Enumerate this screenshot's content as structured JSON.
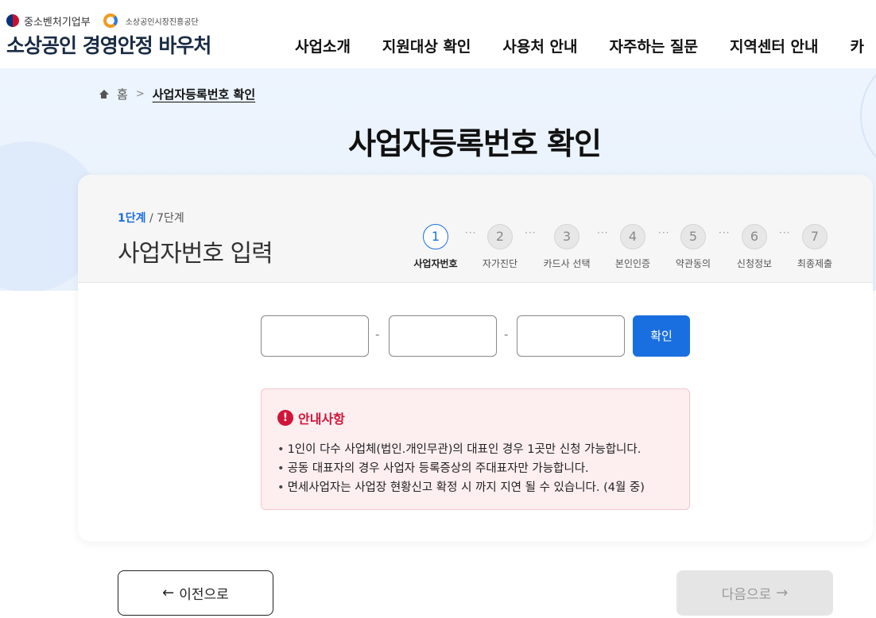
{
  "header": {
    "ministry": "중소벤처기업부",
    "agency": "소상공인시장진흥공단",
    "site_title": "소상공인 경영안정 바우처",
    "nav": [
      "사업소개",
      "지원대상 확인",
      "사용처 안내",
      "자주하는 질문",
      "지역센터 안내",
      "카"
    ]
  },
  "breadcrumb": {
    "home": "홈",
    "current": "사업자등록번호 확인"
  },
  "page_title": "사업자등록번호 확인",
  "stepper": {
    "current_label": "1단계",
    "total_label": " / 7단계",
    "section_title": "사업자번호 입력",
    "steps": [
      {
        "num": "1",
        "label": "사업자번호",
        "active": true
      },
      {
        "num": "2",
        "label": "자가진단",
        "active": false
      },
      {
        "num": "3",
        "label": "카드사 선택",
        "active": false
      },
      {
        "num": "4",
        "label": "본인인증",
        "active": false
      },
      {
        "num": "5",
        "label": "약관동의",
        "active": false
      },
      {
        "num": "6",
        "label": "신청정보",
        "active": false
      },
      {
        "num": "7",
        "label": "최종제출",
        "active": false
      }
    ],
    "separator": "···"
  },
  "form": {
    "part1_value": "",
    "part2_value": "",
    "part3_value": "",
    "dash": "-",
    "confirm_label": "확인"
  },
  "notice": {
    "title": "안내사항",
    "items": [
      "1인이 다수 사업체(법인.개인무관)의 대표인 경우 1곳만 신청 가능합니다.",
      "공동 대표자의 경우 사업자 등록증상의 주대표자만 가능합니다.",
      "면세사업자는 사업장 현황신고 확정 시 까지 지연 될 수 있습니다. (4월 중)"
    ]
  },
  "footer_buttons": {
    "prev": "이전으로",
    "next": "다음으로"
  },
  "colors": {
    "primary": "#1a6fe0",
    "alert": "#d1153a",
    "notice_bg": "#fdeef0",
    "hero_bg": "#edf4fd"
  },
  "icons": {
    "home": "home-icon",
    "alert": "exclamation-icon",
    "prev": "arrow-left-icon",
    "next": "arrow-right-icon"
  }
}
